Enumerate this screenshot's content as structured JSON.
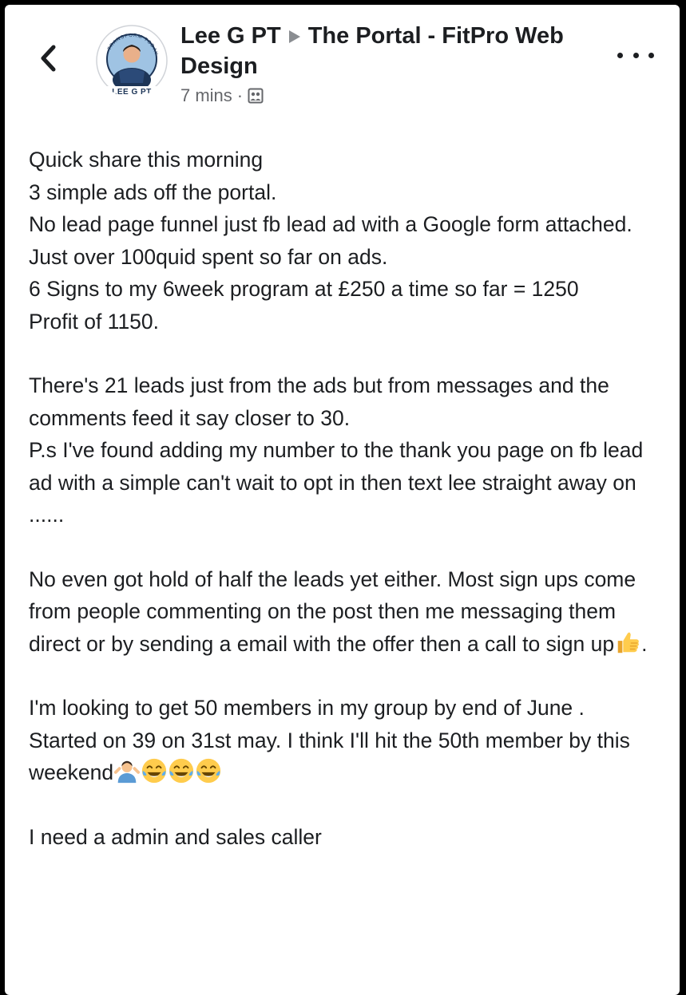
{
  "post": {
    "author": "Lee G PT",
    "group": "The Portal - FitPro Web Design",
    "timestamp": "7 mins",
    "separator": "·",
    "audience_icon": "group-icon",
    "avatar_text": "LEE G PT",
    "actions": {
      "back_icon": "chevron-left-icon",
      "more_icon": "more-options-icon"
    },
    "body": {
      "p1": [
        "Quick share this morning",
        "3 simple ads off the portal.",
        "No lead page funnel just fb lead ad with a Google form attached.",
        "Just over 100quid spent so far on ads.",
        "6 Signs to my 6week program at £250  a time so far = 1250",
        "Profit of 1150."
      ],
      "p2": [
        "There's 21 leads just from the ads but from messages and the comments feed it say closer to 30.",
        "P.s I've found adding my number to the thank you page on fb lead ad with a simple can't wait to opt in then text lee straight away on ......"
      ],
      "p3_text": "No even got hold of half the leads yet either. Most sign ups come from people commenting on the post then me messaging them direct or by sending a email with the offer then a call to sign up",
      "p3_end": ".",
      "p4": [
        "I'm looking to get 50 members in my group by end of June .",
        "Started on 39 on 31st may. I think I'll hit the 50th member by this weekend"
      ],
      "p5": "I need a admin and sales caller",
      "emojis": {
        "thumbs_up": "thumbs-up-emoji",
        "shrug": "man-shrugging-emoji",
        "laughing": "face-with-tears-of-joy-emoji"
      }
    }
  }
}
